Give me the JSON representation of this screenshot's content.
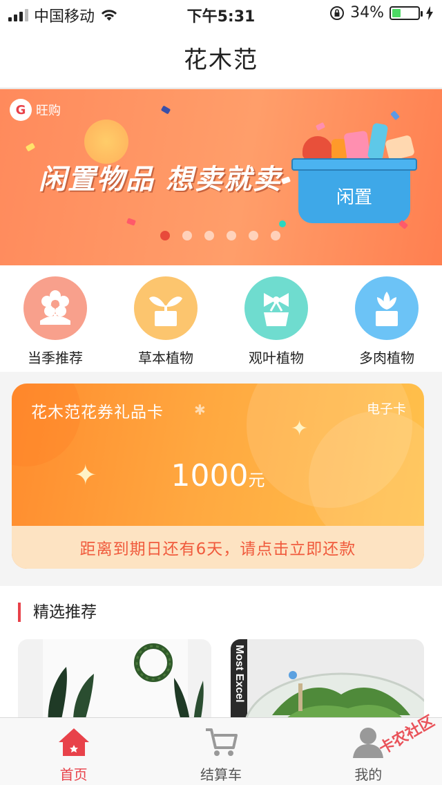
{
  "status_bar": {
    "carrier": "中国移动",
    "time": "下午5:31",
    "battery_percent": "34%",
    "battery_level": 0.34
  },
  "header": {
    "title": "花木范"
  },
  "banner": {
    "brand": "旺购",
    "slogan": "闲置物品 想卖就卖",
    "basket_label": "闲置",
    "slide_count": 6,
    "active_slide": 0
  },
  "categories": [
    {
      "label": "当季推荐",
      "icon": "flower-icon",
      "color": "#f8a08c"
    },
    {
      "label": "草本植物",
      "icon": "sprout-pot-icon",
      "color": "#fcc56e"
    },
    {
      "label": "观叶植物",
      "icon": "bow-pot-icon",
      "color": "#6fdccf"
    },
    {
      "label": "多肉植物",
      "icon": "succulent-icon",
      "color": "#6cc3f6"
    }
  ],
  "gift_card": {
    "title": "花木范花券礼品卡",
    "type": "电子卡",
    "amount": "1000",
    "unit": "元",
    "notice": "距离到期日还有6天，请点击立即还款"
  },
  "featured": {
    "title": "精选推荐",
    "products": [
      {
        "image": "tropical-leaves-wreath-photo"
      },
      {
        "image": "glass-terrarium-photo",
        "book_text": "Most Excel"
      }
    ]
  },
  "tabbar": [
    {
      "label": "首页",
      "icon": "home-icon",
      "active": true
    },
    {
      "label": "结算车",
      "icon": "cart-icon",
      "active": false
    },
    {
      "label": "我的",
      "icon": "user-icon",
      "active": false
    }
  ],
  "watermark": "卡农社区",
  "colors": {
    "accent": "#e8424a",
    "card_orange": "#ffa840",
    "banner_orange": "#ff8a5c"
  }
}
